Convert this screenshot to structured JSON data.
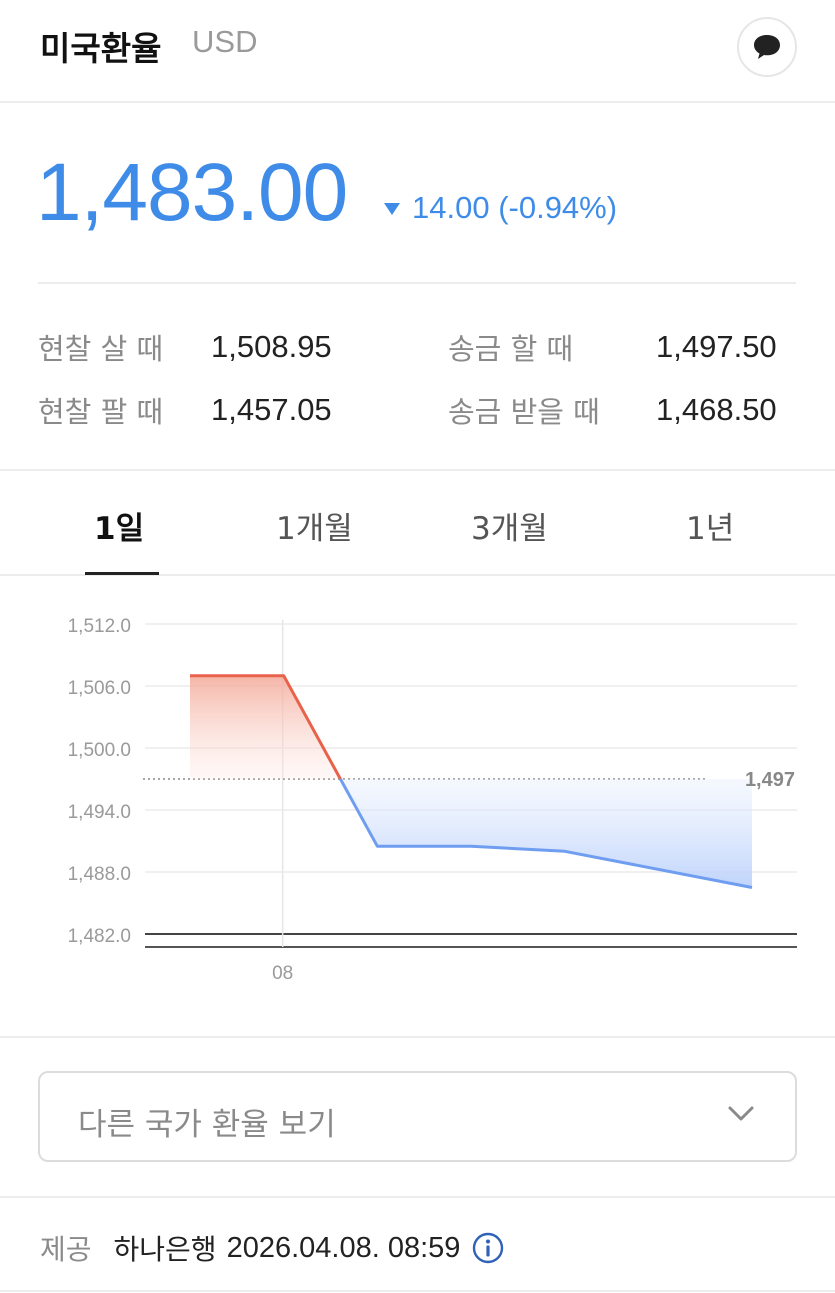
{
  "header": {
    "title": "미국환율",
    "currency": "USD",
    "comment_icon": "speech-bubble-icon"
  },
  "quote": {
    "price": "1,483.00",
    "change": "14.00 (-0.94%)",
    "direction_icon": "down-triangle-icon",
    "color": "#3f8ce8"
  },
  "rates": [
    {
      "label": "현찰 살 때",
      "value": "1,508.95"
    },
    {
      "label": "송금 할 때",
      "value": "1,497.50"
    },
    {
      "label": "현찰 팔 때",
      "value": "1,457.05"
    },
    {
      "label": "송금 받을 때",
      "value": "1,468.50"
    }
  ],
  "tabs": [
    {
      "label": "1일",
      "active": true
    },
    {
      "label": "1개월",
      "active": false
    },
    {
      "label": "3개월",
      "active": false
    },
    {
      "label": "1년",
      "active": false
    }
  ],
  "chart_data": {
    "type": "line",
    "y_ticks": [
      "1,512.0",
      "1,506.0",
      "1,500.0",
      "1,494.0",
      "1,488.0",
      "1,482.0"
    ],
    "ylim": [
      1482,
      1512
    ],
    "x_ticks": [
      {
        "label": "08",
        "x": 1
      }
    ],
    "xlim": [
      0,
      6.5
    ],
    "reference": {
      "value": 1497,
      "label": "1,497"
    },
    "series": [
      {
        "points": [
          [
            0,
            1507
          ],
          [
            1,
            1507
          ],
          [
            2,
            1490.5
          ],
          [
            3,
            1490.5
          ],
          [
            4,
            1490
          ],
          [
            6,
            1486.5
          ]
        ]
      }
    ],
    "colors": {
      "above": "#e8614a",
      "below": "#6f9df0"
    }
  },
  "dropdown": {
    "label": "다른 국가 환율 보기",
    "icon": "chevron-down-icon"
  },
  "footer": {
    "provider_label": "제공",
    "provider": "하나은행",
    "timestamp": "2026.04.08. 08:59",
    "info_icon": "info-icon"
  }
}
